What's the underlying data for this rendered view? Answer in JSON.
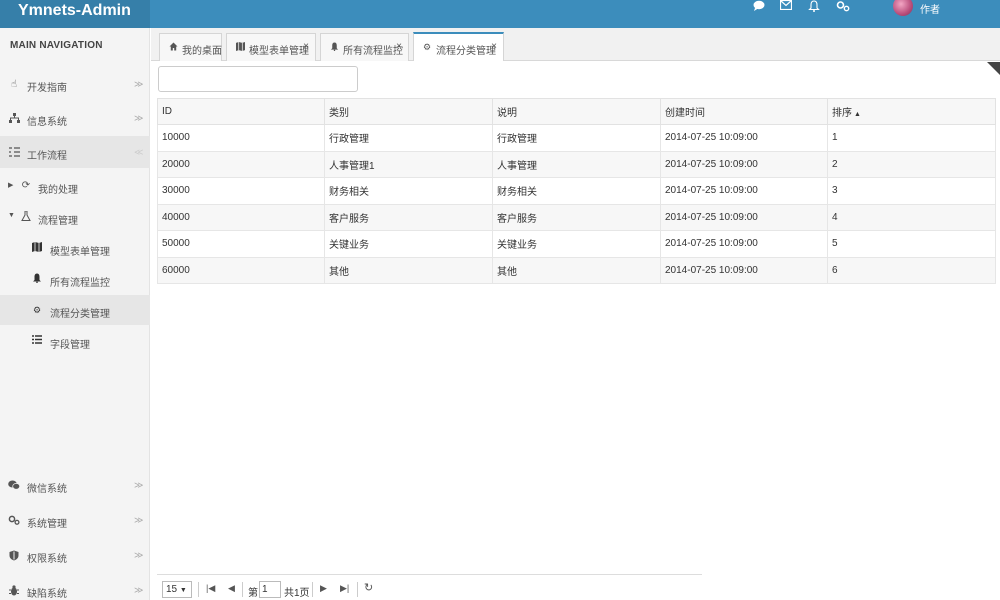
{
  "header": {
    "brand": "Ymnets-Admin",
    "user_name": "作者",
    "icons": [
      "chat-icon",
      "envelope-icon",
      "bell-icon",
      "settings-icon"
    ]
  },
  "sidebar": {
    "nav_header": "MAIN NAVIGATION",
    "items": [
      {
        "label": "开发指南",
        "icon": "hand-pointer-icon"
      },
      {
        "label": "信息系统",
        "icon": "sitemap-icon"
      },
      {
        "label": "工作流程",
        "icon": "list-indent-icon"
      },
      {
        "label": "微信系统",
        "icon": "wechat-icon"
      },
      {
        "label": "系统管理",
        "icon": "gears-icon"
      },
      {
        "label": "权限系统",
        "icon": "shield-icon"
      },
      {
        "label": "缺陷系统",
        "icon": "bug-icon"
      }
    ],
    "subitems": [
      {
        "label": "我的处理",
        "icon": "refresh-icon",
        "expanded": false
      },
      {
        "label": "流程管理",
        "icon": "flask-icon",
        "expanded": true
      }
    ],
    "subsubitems": [
      {
        "label": "模型表单管理",
        "icon": "map-icon"
      },
      {
        "label": "所有流程监控",
        "icon": "bell-icon"
      },
      {
        "label": "流程分类管理",
        "icon": "gear-icon",
        "active": true
      },
      {
        "label": "字段管理",
        "icon": "list-icon"
      }
    ]
  },
  "tabs": [
    {
      "label": "我的桌面",
      "icon": "home-icon",
      "closable": false
    },
    {
      "label": "模型表单管理",
      "icon": "map-icon",
      "closable": true
    },
    {
      "label": "所有流程监控",
      "icon": "bell-icon",
      "closable": true
    },
    {
      "label": "流程分类管理",
      "icon": "gear-icon",
      "closable": true,
      "active": true
    }
  ],
  "search": {
    "value": ""
  },
  "grid": {
    "columns": [
      "ID",
      "类别",
      "说明",
      "创建时间",
      "排序"
    ],
    "sort_column": "排序",
    "sort_direction": "ascending",
    "rows": [
      [
        "10000",
        "行政管理",
        "行政管理",
        "2014-07-25 10:09:00",
        "1"
      ],
      [
        "20000",
        "人事管理1",
        "人事管理",
        "2014-07-25 10:09:00",
        "2"
      ],
      [
        "30000",
        "财务相关",
        "财务相关",
        "2014-07-25 10:09:00",
        "3"
      ],
      [
        "40000",
        "客户服务",
        "客户服务",
        "2014-07-25 10:09:00",
        "4"
      ],
      [
        "50000",
        "关键业务",
        "关键业务",
        "2014-07-25 10:09:00",
        "5"
      ],
      [
        "60000",
        "其他",
        "其他",
        "2014-07-25 10:09:00",
        "6"
      ]
    ]
  },
  "pager": {
    "page_size": "15",
    "page_prefix": "第",
    "page_number": "1",
    "total_pages": "共1页"
  },
  "colors": {
    "header": "#3c8dbc",
    "brand": "#367fa9",
    "sidebar": "#f4f4f4"
  }
}
